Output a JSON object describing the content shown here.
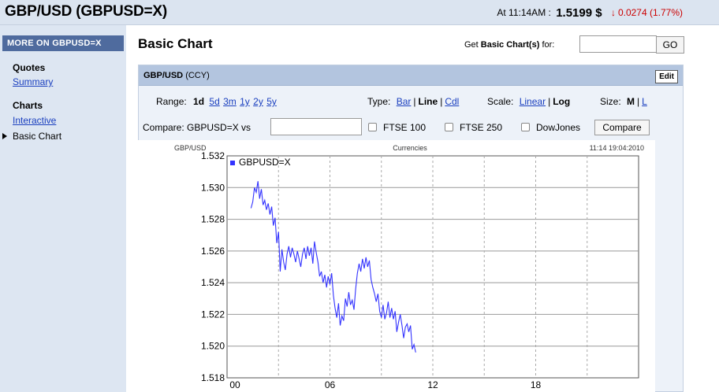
{
  "header": {
    "title": "GBP/USD (GBPUSD=X)",
    "at_time": "At 11:14AM :",
    "price": "1.5199 $",
    "change": "0.0274 (1.77%)"
  },
  "sidebar": {
    "heading": "MORE ON GBPUSD=X",
    "groups": [
      {
        "label": "Quotes",
        "items": [
          "Summary"
        ]
      },
      {
        "label": "Charts",
        "items": [
          "Interactive",
          "Basic Chart"
        ]
      }
    ]
  },
  "main": {
    "title": "Basic Chart",
    "get_label_pre": "Get",
    "get_label_bold": "Basic Chart(s)",
    "get_label_post": "for:",
    "go_label": "GO"
  },
  "panel": {
    "symbol": "GBP/USD",
    "type_tag": "(CCY)",
    "edit_label": "Edit",
    "range_label": "Range:",
    "ranges": [
      "1d",
      "5d",
      "3m",
      "1y",
      "2y",
      "5y"
    ],
    "range_selected": "1d",
    "type_label": "Type:",
    "types": [
      "Bar",
      "Line",
      "Cdl"
    ],
    "type_selected": "Line",
    "scale_label": "Scale:",
    "scales": [
      "Linear",
      "Log"
    ],
    "scale_selected": "Log",
    "size_label": "Size:",
    "sizes": [
      "M",
      "L"
    ],
    "size_selected": "M",
    "compare_label": "Compare: GBPUSD=X vs",
    "compare_options": [
      "FTSE 100",
      "FTSE 250",
      "DowJones"
    ],
    "compare_button": "Compare"
  },
  "chart_data": {
    "type": "line",
    "title": "Currencies",
    "ylabel": "GBP/USD",
    "timestamp": "11:14 19:04:2010",
    "series": [
      {
        "name": "GBPUSD=X",
        "color": "#3333ff",
        "x": [
          1.4,
          1.5,
          1.6,
          1.7,
          1.8,
          1.9,
          2.0,
          2.1,
          2.2,
          2.3,
          2.4,
          2.5,
          2.6,
          2.7,
          2.8,
          2.9,
          3.0,
          3.1,
          3.2,
          3.3,
          3.4,
          3.5,
          3.6,
          3.7,
          3.8,
          3.9,
          4.0,
          4.1,
          4.2,
          4.3,
          4.4,
          4.5,
          4.6,
          4.7,
          4.8,
          4.9,
          5.0,
          5.1,
          5.2,
          5.3,
          5.4,
          5.5,
          5.6,
          5.7,
          5.8,
          5.9,
          6.0,
          6.1,
          6.2,
          6.3,
          6.4,
          6.5,
          6.6,
          6.7,
          6.8,
          6.9,
          7.0,
          7.1,
          7.2,
          7.3,
          7.4,
          7.5,
          7.6,
          7.7,
          7.8,
          7.9,
          8.0,
          8.1,
          8.2,
          8.3,
          8.4,
          8.5,
          8.6,
          8.7,
          8.8,
          8.9,
          9.0,
          9.1,
          9.2,
          9.3,
          9.4,
          9.5,
          9.6,
          9.7,
          9.8,
          9.9,
          10.0,
          10.1,
          10.2,
          10.3,
          10.4,
          10.5,
          10.6,
          10.7,
          10.8,
          10.9,
          11.0
        ],
        "values": [
          1.5287,
          1.5291,
          1.53,
          1.5297,
          1.5304,
          1.5293,
          1.5299,
          1.5289,
          1.5292,
          1.5286,
          1.529,
          1.5283,
          1.5288,
          1.5276,
          1.5281,
          1.5265,
          1.5272,
          1.5247,
          1.5261,
          1.5253,
          1.5248,
          1.5258,
          1.5263,
          1.5256,
          1.5262,
          1.5258,
          1.5253,
          1.526,
          1.5255,
          1.525,
          1.5258,
          1.5262,
          1.5255,
          1.5263,
          1.5257,
          1.5262,
          1.5252,
          1.5266,
          1.5259,
          1.5253,
          1.5244,
          1.5247,
          1.524,
          1.5245,
          1.5237,
          1.5244,
          1.5239,
          1.5246,
          1.5232,
          1.5224,
          1.5218,
          1.5227,
          1.5213,
          1.5219,
          1.5216,
          1.523,
          1.5225,
          1.5234,
          1.5226,
          1.5229,
          1.5223,
          1.5236,
          1.5246,
          1.5252,
          1.5247,
          1.5255,
          1.5249,
          1.5256,
          1.525,
          1.5254,
          1.5242,
          1.5237,
          1.5233,
          1.5228,
          1.5233,
          1.5222,
          1.5218,
          1.5226,
          1.5217,
          1.5221,
          1.5228,
          1.5218,
          1.5224,
          1.5217,
          1.5222,
          1.5209,
          1.5215,
          1.522,
          1.5213,
          1.5205,
          1.5212,
          1.5214,
          1.5209,
          1.5213,
          1.5198,
          1.5201,
          1.5196
        ],
        "last": 1.5196
      }
    ],
    "ylim": [
      1.518,
      1.532
    ],
    "yticks": [
      "1.532",
      "1.530",
      "1.528",
      "1.526",
      "1.524",
      "1.522",
      "1.520",
      "1.518"
    ],
    "xlim": [
      0,
      24
    ],
    "xticks": [
      "00",
      "06",
      "12",
      "18"
    ],
    "grid": true,
    "legend": "top-left"
  }
}
